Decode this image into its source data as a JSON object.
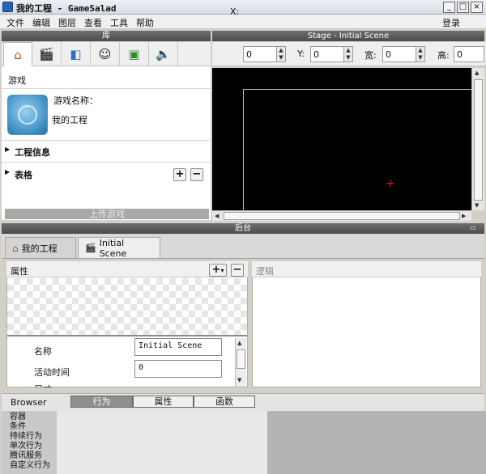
{
  "window": {
    "title": "我的工程 - GameSalad",
    "minimize": "_",
    "maximize": "□",
    "close": "×"
  },
  "menu": {
    "items": [
      "文件",
      "编辑",
      "图层",
      "查看",
      "工具",
      "帮助"
    ],
    "login": "登录"
  },
  "library": {
    "header": "库",
    "tabs": [
      {
        "icon": "home-icon",
        "glyph": "⌂"
      },
      {
        "icon": "clapper-icon",
        "glyph": "🎬"
      },
      {
        "icon": "cube-icon",
        "glyph": "◧"
      },
      {
        "icon": "mask-icon",
        "glyph": "☺"
      },
      {
        "icon": "image-icon",
        "glyph": "▣"
      },
      {
        "icon": "speaker-icon",
        "glyph": "🔈"
      }
    ],
    "section_game": "游戏",
    "game_name_label": "游戏名称：",
    "game_name_value": "我的工程",
    "project_info": "工程信息",
    "tables": "表格",
    "upload_game": "上传游戏",
    "add": "+",
    "remove": "−"
  },
  "stage": {
    "header": "Stage - Initial Scene",
    "x_label": "X:",
    "x_value": "0",
    "y_label": "Y:",
    "y_value": "0",
    "w_label": "宽:",
    "w_value": "0",
    "h_label": "高:",
    "h_value": "0"
  },
  "backstage": {
    "header": "后台",
    "tabs": [
      {
        "label": "我的工程",
        "icon": "home-icon"
      },
      {
        "label": "Initial Scene",
        "icon": "clapper-icon"
      }
    ],
    "attributes_label": "属性",
    "logic_label": "逻辑",
    "add": "+",
    "dropdown": "▾",
    "remove": "−",
    "properties": [
      {
        "label": "名称",
        "value": "Initial Scene"
      },
      {
        "label": "活动时间",
        "value": "0"
      }
    ],
    "partial_label": "尺寸"
  },
  "browser": {
    "label": "Browser",
    "tabs": [
      "行为",
      "属性",
      "函数"
    ],
    "list": [
      "容器",
      "条件",
      "持续行为",
      "单次行为",
      "腾讯服务",
      "自定义行为"
    ]
  },
  "colors": {
    "crosshair": "#d01818",
    "panel_header": "#555555",
    "stage_bg": "#000000"
  }
}
